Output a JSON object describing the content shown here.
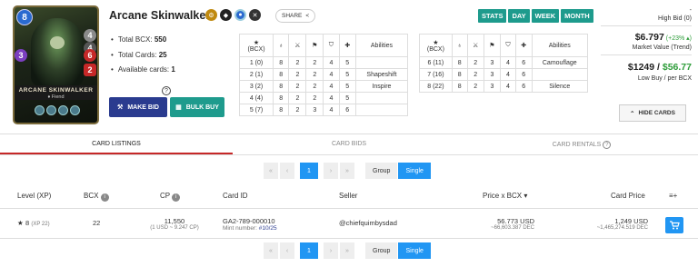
{
  "card": {
    "name": "Arcane Skinwalker",
    "mana": "8",
    "art_title": "ARCANE SKINWALKER",
    "art_subtitle": "♦ Fiend",
    "stat_attack": "4",
    "stat_speed": "4",
    "stat_magic": "3",
    "stat_armor": "6",
    "stat_health": "2"
  },
  "share_label": "SHARE",
  "info": {
    "total_bcx_label": "Total BCX:",
    "total_bcx": "550",
    "total_cards_label": "Total Cards:",
    "total_cards": "25",
    "available_label": "Available cards:",
    "available": "1"
  },
  "buttons": {
    "make_bid": "MAKE BID",
    "bulk_buy": "BULK BUY",
    "hide_cards": "HIDE CARDS"
  },
  "level_table_1": {
    "header_bcx": "(BCX)",
    "header_abilities": "Abilities",
    "rows": [
      [
        "1 (0)",
        "8",
        "2",
        "2",
        "4",
        "5",
        ""
      ],
      [
        "2 (1)",
        "8",
        "2",
        "2",
        "4",
        "5",
        "Shapeshift"
      ],
      [
        "3 (2)",
        "8",
        "2",
        "2",
        "4",
        "5",
        "Inspire"
      ],
      [
        "4 (4)",
        "8",
        "2",
        "2",
        "4",
        "5",
        ""
      ],
      [
        "5 (7)",
        "8",
        "2",
        "3",
        "4",
        "6",
        ""
      ]
    ]
  },
  "level_table_2": {
    "header_bcx": "(BCX)",
    "header_abilities": "Abilities",
    "rows": [
      [
        "6 (11)",
        "8",
        "2",
        "3",
        "4",
        "6",
        "Camouflage"
      ],
      [
        "7 (16)",
        "8",
        "2",
        "3",
        "4",
        "6",
        ""
      ],
      [
        "8 (22)",
        "8",
        "2",
        "3",
        "4",
        "6",
        "Silence"
      ]
    ]
  },
  "stat_tabs": [
    "STATS",
    "DAY",
    "WEEK",
    "MONTH"
  ],
  "market": {
    "dash": "-",
    "high_bid": "High Bid (0)",
    "market_value": "$6.797",
    "market_change": "(+23% ▴)",
    "market_value_label": "Market Value (Trend)",
    "low_buy": "$1249",
    "slash": " / ",
    "per_bcx": "$56.77",
    "low_buy_label": "Low Buy / per BCX"
  },
  "listing_tabs": [
    "CARD LISTINGS",
    "CARD BIDS",
    "CARD RENTALS"
  ],
  "pager": {
    "first": "«",
    "prev": "‹",
    "page": "1",
    "next": "›",
    "last": "»",
    "group": "Group",
    "single": "Single"
  },
  "columns": {
    "level": "Level (XP)",
    "bcx": "BCX",
    "cp": "CP",
    "card_id": "Card ID",
    "seller": "Seller",
    "price_bcx": "Price x BCX",
    "card_price": "Card Price"
  },
  "listing": {
    "star": "★",
    "level": "8",
    "xp": "(XP 22)",
    "bcx": "22",
    "cp": "11,550",
    "cp_sub": "(1 USD ~ 9.247 CP)",
    "card_id": "GA2-789-000010",
    "mint_label": "Mint number:",
    "mint": "#10/25",
    "seller": "@chiefquimbysdad",
    "price_bcx": "56.773 USD",
    "price_bcx_sub": "~66,603.387 DEC",
    "card_price": "1,249 USD",
    "card_price_sub": "~1,465,274.519 DEC"
  },
  "colors": {
    "teal": "#1e9b8d",
    "navy": "#2a3b8f",
    "blue": "#2196f3",
    "green": "#2e9d3a",
    "red": "#c62828"
  }
}
